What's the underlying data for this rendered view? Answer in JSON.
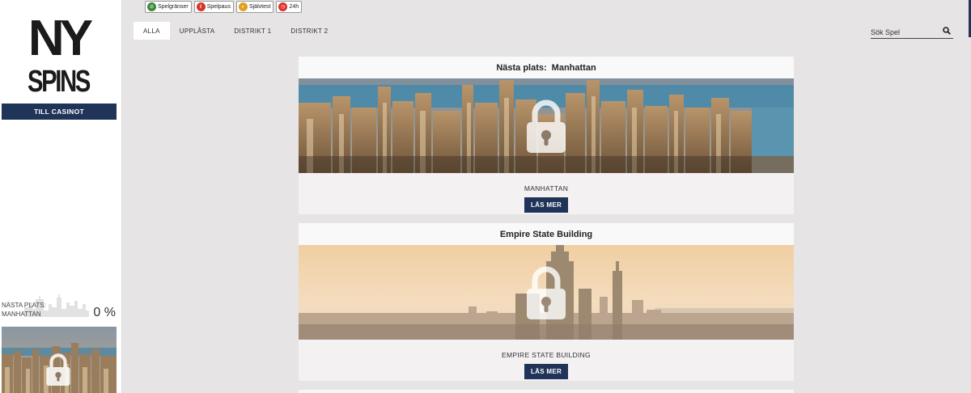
{
  "sidebar": {
    "logo_top": "NY",
    "logo_bottom": "SPINS",
    "casino_button": "TILL CASINOT",
    "next_place_label_1": "NÄSTA PLATS:",
    "next_place_label_2": "MANHATTAN",
    "next_place_percent": "0 %"
  },
  "rg": {
    "items": [
      {
        "label": "Spelgränser",
        "icon": "limits-icon",
        "color": "#3a8a3a"
      },
      {
        "label": "Spelpaus",
        "icon": "pause-icon",
        "color": "#d9342b"
      },
      {
        "label": "Självtest",
        "icon": "selftest-icon",
        "color": "#e0a020"
      },
      {
        "label": "24h",
        "icon": "clock-icon",
        "color": "#d9342b"
      }
    ]
  },
  "tabs": [
    {
      "label": "ALLA",
      "active": true
    },
    {
      "label": "UPPLÅSTA",
      "active": false
    },
    {
      "label": "DISTRIKT 1",
      "active": false
    },
    {
      "label": "DISTRIKT 2",
      "active": false
    }
  ],
  "search": {
    "placeholder": "Sök Spel"
  },
  "cards": [
    {
      "title_prefix": "Nästa plats:",
      "title": "Manhattan",
      "name": "MANHATTAN",
      "button": "LÄS MER",
      "locked": true
    },
    {
      "title_prefix": "",
      "title": "Empire State Building",
      "name": "EMPIRE STATE BUILDING",
      "button": "LÄS MER",
      "locked": true
    }
  ],
  "colors": {
    "navy": "#1f3458",
    "background": "#e6e4e5"
  }
}
